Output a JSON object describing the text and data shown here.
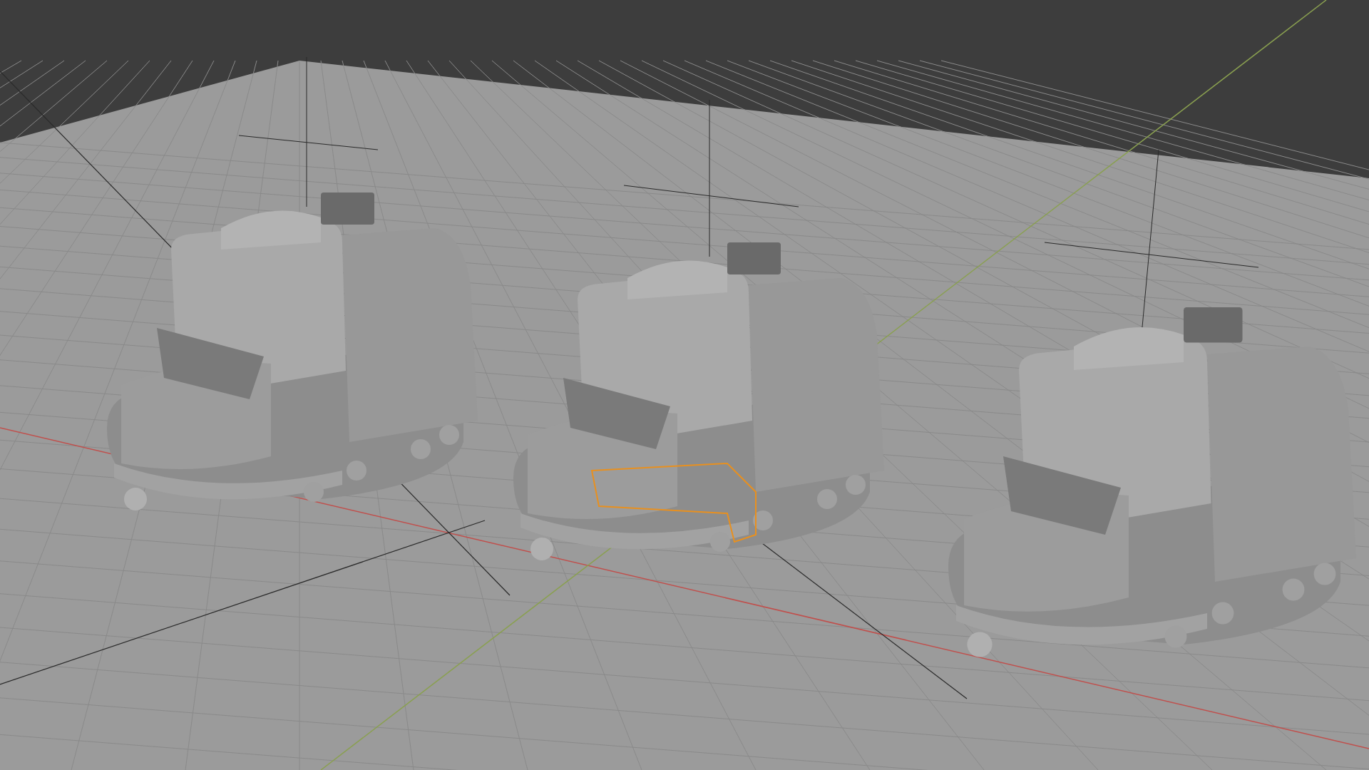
{
  "viewport": {
    "objects": [
      {
        "kind": "vehicle",
        "selected": false
      },
      {
        "kind": "vehicle",
        "selected": true
      },
      {
        "kind": "vehicle",
        "selected": false
      }
    ]
  }
}
